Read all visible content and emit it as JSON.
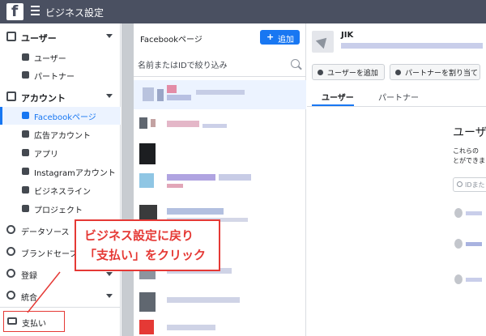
{
  "topbar": {
    "title": "ビジネス設定",
    "logo": "f"
  },
  "sidebar": {
    "users_section": {
      "label": "ユーザー"
    },
    "users_items": [
      {
        "label": "ユーザー"
      },
      {
        "label": "パートナー"
      }
    ],
    "accounts_section": {
      "label": "アカウント"
    },
    "accounts_items": [
      {
        "label": "Facebookページ",
        "active": true
      },
      {
        "label": "広告アカウント"
      },
      {
        "label": "アプリ"
      },
      {
        "label": "Instagramアカウント"
      },
      {
        "label": "ビジネスライン"
      },
      {
        "label": "プロジェクト"
      }
    ],
    "main_items": [
      {
        "label": "データソース"
      },
      {
        "label": "ブランドセーフ"
      },
      {
        "label": "登録"
      },
      {
        "label": "統合"
      }
    ],
    "payment": {
      "label": "支払い"
    }
  },
  "pages": {
    "title": "Facebookページ",
    "add_button": "追加",
    "search_placeholder": "名前またはIDで絞り込み"
  },
  "right": {
    "page_name": "JIK",
    "add_user_button": "ユーザーを追加",
    "partner_button": "パートナーを割り当て",
    "tabs": [
      {
        "label": "ユーザー",
        "active": true
      },
      {
        "label": "パートナー"
      }
    ],
    "users_heading": "ユーザー",
    "users_desc_line1": "これらの",
    "users_desc_line2": "とができま",
    "users_search_placeholder": "IDまた"
  },
  "callout": {
    "line1": "ビジネス設定に戻り",
    "line2": "「支払い」をクリック"
  },
  "colors": {
    "topbar": "#4a5061",
    "accent": "#1877f2",
    "callout": "#e53935"
  }
}
